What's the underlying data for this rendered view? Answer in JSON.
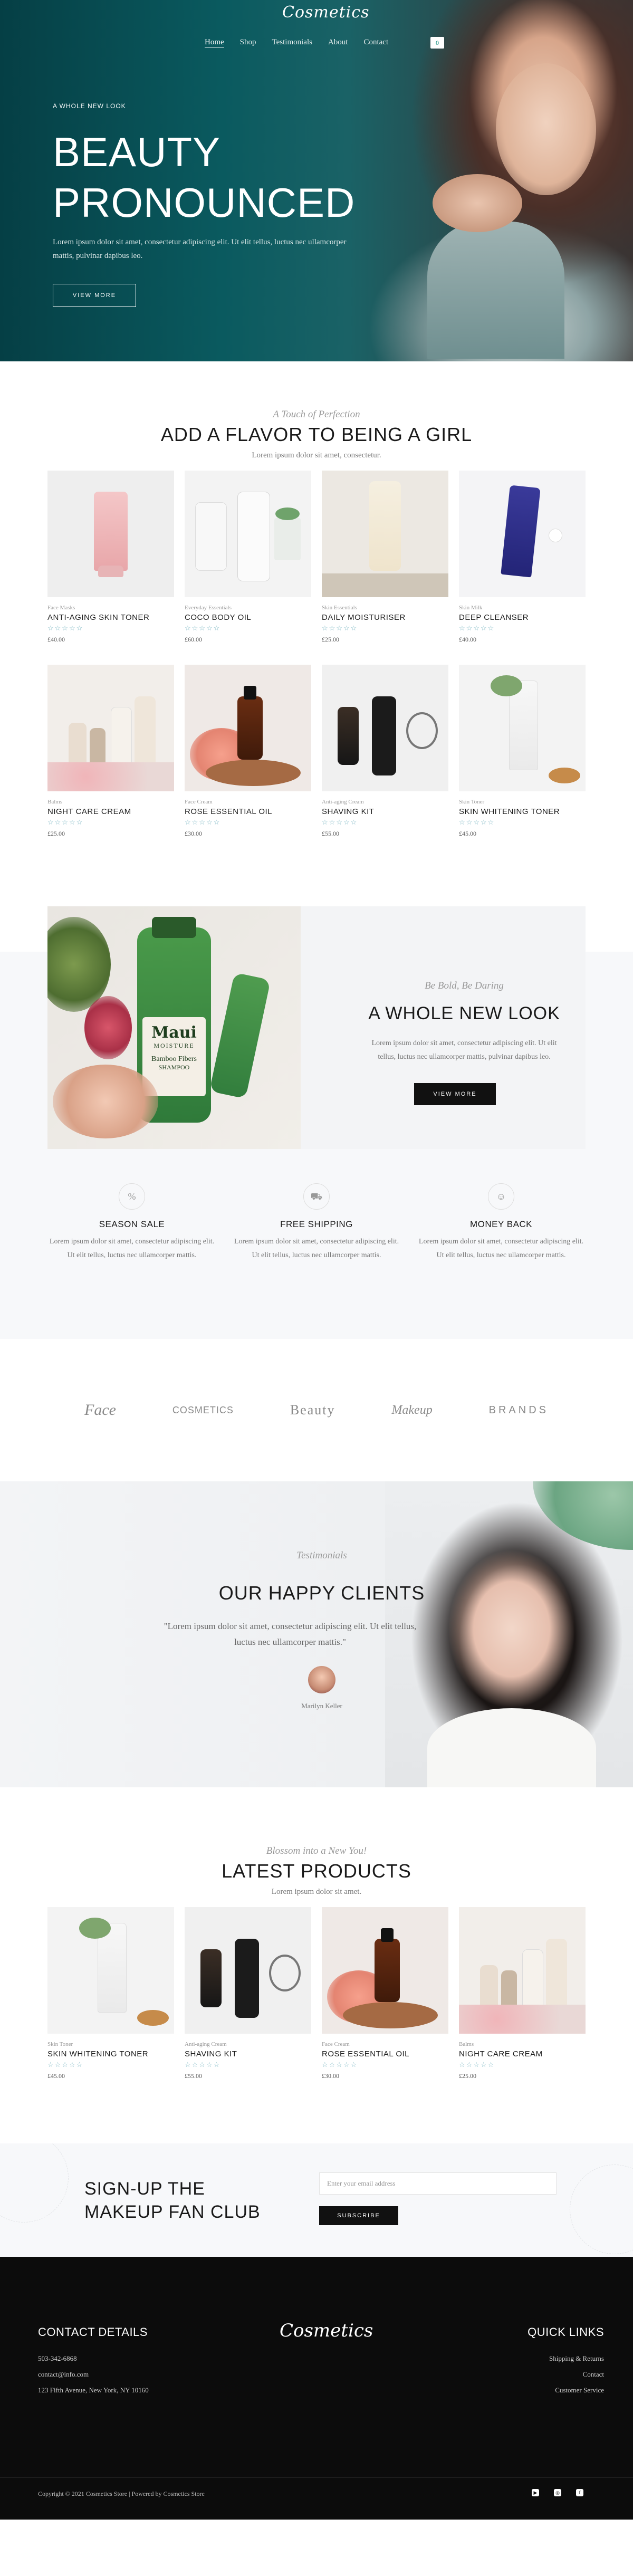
{
  "nav": {
    "logo": "Cosmetics",
    "menu": [
      "Home",
      "Shop",
      "Testimonials",
      "About",
      "Contact"
    ],
    "cart_count": "0"
  },
  "hero": {
    "kicker": "A WHOLE NEW LOOK",
    "title_line1": "BEAUTY",
    "title_line2": "PRONOUNCED",
    "text": "Lorem ipsum dolor sit amet, consectetur adipiscing elit. Ut elit tellus, luctus nec ullamcorper mattis, pulvinar dapibus leo.",
    "button": "VIEW MORE"
  },
  "flavor": {
    "script": "A Touch of Perfection",
    "title": "ADD A FLAVOR TO BEING A GIRL",
    "subtitle": "Lorem ipsum dolor sit amet, consectetur.",
    "products": [
      {
        "category": "Face Masks",
        "name": "ANTI-AGING SKIN TONER",
        "stars": "☆☆☆☆☆",
        "price": "£40.00"
      },
      {
        "category": "Everyday Essentials",
        "name": "COCO BODY OIL",
        "stars": "☆☆☆☆☆",
        "price": "£60.00"
      },
      {
        "category": "Skin Essentials",
        "name": "DAILY MOISTURISER",
        "stars": "☆☆☆☆☆",
        "price": "£25.00"
      },
      {
        "category": "Skin Milk",
        "name": "DEEP CLEANSER",
        "stars": "☆☆☆☆☆",
        "price": "£40.00"
      },
      {
        "category": "Balms",
        "name": "NIGHT CARE CREAM",
        "stars": "☆☆☆☆☆",
        "price": "£25.00"
      },
      {
        "category": "Face Cream",
        "name": "ROSE ESSENTIAL OIL",
        "stars": "☆☆☆☆☆",
        "price": "£30.00"
      },
      {
        "category": "Anti-aging Cream",
        "name": "SHAVING KIT",
        "stars": "☆☆☆☆☆",
        "price": "£55.00"
      },
      {
        "category": "Skin Toner",
        "name": "SKIN WHITENING TONER",
        "stars": "☆☆☆☆☆",
        "price": "£45.00"
      }
    ]
  },
  "feature": {
    "script": "Be Bold, Be Daring",
    "title": "A WHOLE NEW LOOK",
    "text": "Lorem ipsum dolor sit amet, consectetur adipiscing elit. Ut elit tellus, luctus nec ullamcorper mattis, pulvinar dapibus leo.",
    "button": "VIEW MORE",
    "bottle_brand": "Maui",
    "bottle_sub": "MOISTURE",
    "bottle_text1": "Bamboo Fibers",
    "bottle_text2": "SHAMPOO"
  },
  "perks": [
    {
      "icon": "%",
      "title": "SEASON SALE",
      "text": "Lorem ipsum dolor sit amet, consectetur adipiscing elit. Ut elit tellus, luctus nec ullamcorper mattis."
    },
    {
      "icon": "⛟",
      "title": "FREE SHIPPING",
      "text": "Lorem ipsum dolor sit amet, consectetur adipiscing elit. Ut elit tellus, luctus nec ullamcorper mattis."
    },
    {
      "icon": "☺",
      "title": "MONEY BACK",
      "text": "Lorem ipsum dolor sit amet, consectetur adipiscing elit. Ut elit tellus, luctus nec ullamcorper mattis."
    }
  ],
  "brands": [
    "Face",
    "COSMETICS",
    "Beauty",
    "Makeup",
    "BRANDS"
  ],
  "testimonials": {
    "script": "Testimonials",
    "title": "OUR HAPPY CLIENTS",
    "quote": "\"Lorem ipsum dolor sit amet, consectetur adipiscing elit. Ut elit tellus, luctus nec ullamcorper mattis.\"",
    "name": "Marilyn Keller"
  },
  "latest": {
    "script": "Blossom into a New You!",
    "title": "LATEST PRODUCTS",
    "subtitle": "Lorem ipsum dolor sit amet.",
    "products": [
      {
        "category": "Skin Toner",
        "name": "SKIN WHITENING TONER",
        "stars": "☆☆☆☆☆",
        "price": "£45.00"
      },
      {
        "category": "Anti-aging Cream",
        "name": "SHAVING KIT",
        "stars": "☆☆☆☆☆",
        "price": "£55.00"
      },
      {
        "category": "Face Cream",
        "name": "ROSE ESSENTIAL OIL",
        "stars": "☆☆☆☆☆",
        "price": "£30.00"
      },
      {
        "category": "Balms",
        "name": "NIGHT CARE CREAM",
        "stars": "☆☆☆☆☆",
        "price": "£25.00"
      }
    ]
  },
  "newsletter": {
    "title_line1": "SIGN-UP THE",
    "title_line2": "MAKEUP FAN CLUB",
    "placeholder": "Enter your email address",
    "button": "SUBSCRIBE"
  },
  "footer": {
    "contact_title": "CONTACT DETAILS",
    "phone": "503-342-6868",
    "email": "contact@info.com",
    "address": "123 Fifth Avenue, New York, NY 10160",
    "logo": "Cosmetics",
    "links_title": "QUICK LINKS",
    "links": [
      "Shipping & Returns",
      "Contact",
      "Customer Service"
    ],
    "copyright": "Copyright © 2021 Cosmetics Store | Powered by Cosmetics Store",
    "social": [
      "▶",
      "◎",
      "f"
    ]
  },
  "colors": {
    "hero_teal": "#0a5a5f",
    "accent_stars": "#7fb8c4",
    "dark": "#111111"
  }
}
